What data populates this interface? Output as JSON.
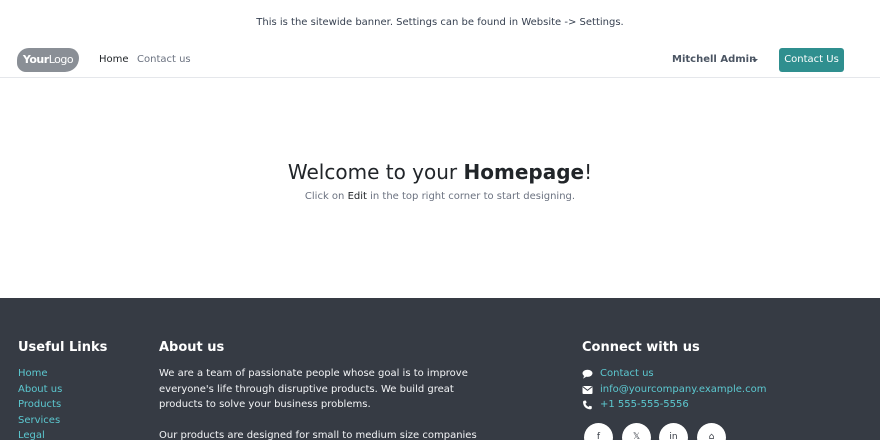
{
  "banner": {
    "text": "This is the sitewide banner.  Settings can be found in Website -> Settings."
  },
  "navbar": {
    "logo_bold": "Your",
    "logo_light": "Logo",
    "links": [
      {
        "label": "Home"
      },
      {
        "label": "Contact us"
      }
    ],
    "user": "Mitchell Admin",
    "cta": "Contact Us"
  },
  "hero": {
    "title_pre": "Welcome to your ",
    "title_bold": "Homepage",
    "title_post": "!",
    "sub_pre": "Click on ",
    "sub_edit": "Edit",
    "sub_post": " in the top right corner to start designing."
  },
  "footer": {
    "useful_links": {
      "heading": "Useful Links",
      "items": [
        "Home",
        "About us",
        "Products",
        "Services",
        "Legal"
      ]
    },
    "about": {
      "heading": "About us",
      "para1": "We are a team of passionate people whose goal is to improve everyone's life through disruptive products. We build great products to solve your business problems.",
      "para2": "Our products are designed for small to medium size companies willing to"
    },
    "connect": {
      "heading": "Connect with us",
      "items": [
        {
          "label": "Contact us",
          "icon": "comment-icon"
        },
        {
          "label": "info@yourcompany.example.com",
          "icon": "envelope-icon"
        },
        {
          "label": "+1 555-555-5556",
          "icon": "phone-icon"
        }
      ],
      "social": [
        {
          "icon": "facebook-icon",
          "glyph": "f"
        },
        {
          "icon": "x-icon",
          "glyph": "𝕏"
        },
        {
          "icon": "linkedin-icon",
          "glyph": "in"
        },
        {
          "icon": "home-icon",
          "glyph": "⌂"
        }
      ]
    }
  },
  "colors": {
    "accent": "#2f8f8f",
    "footer_bg": "#363b44",
    "link": "#5cc8d0"
  }
}
